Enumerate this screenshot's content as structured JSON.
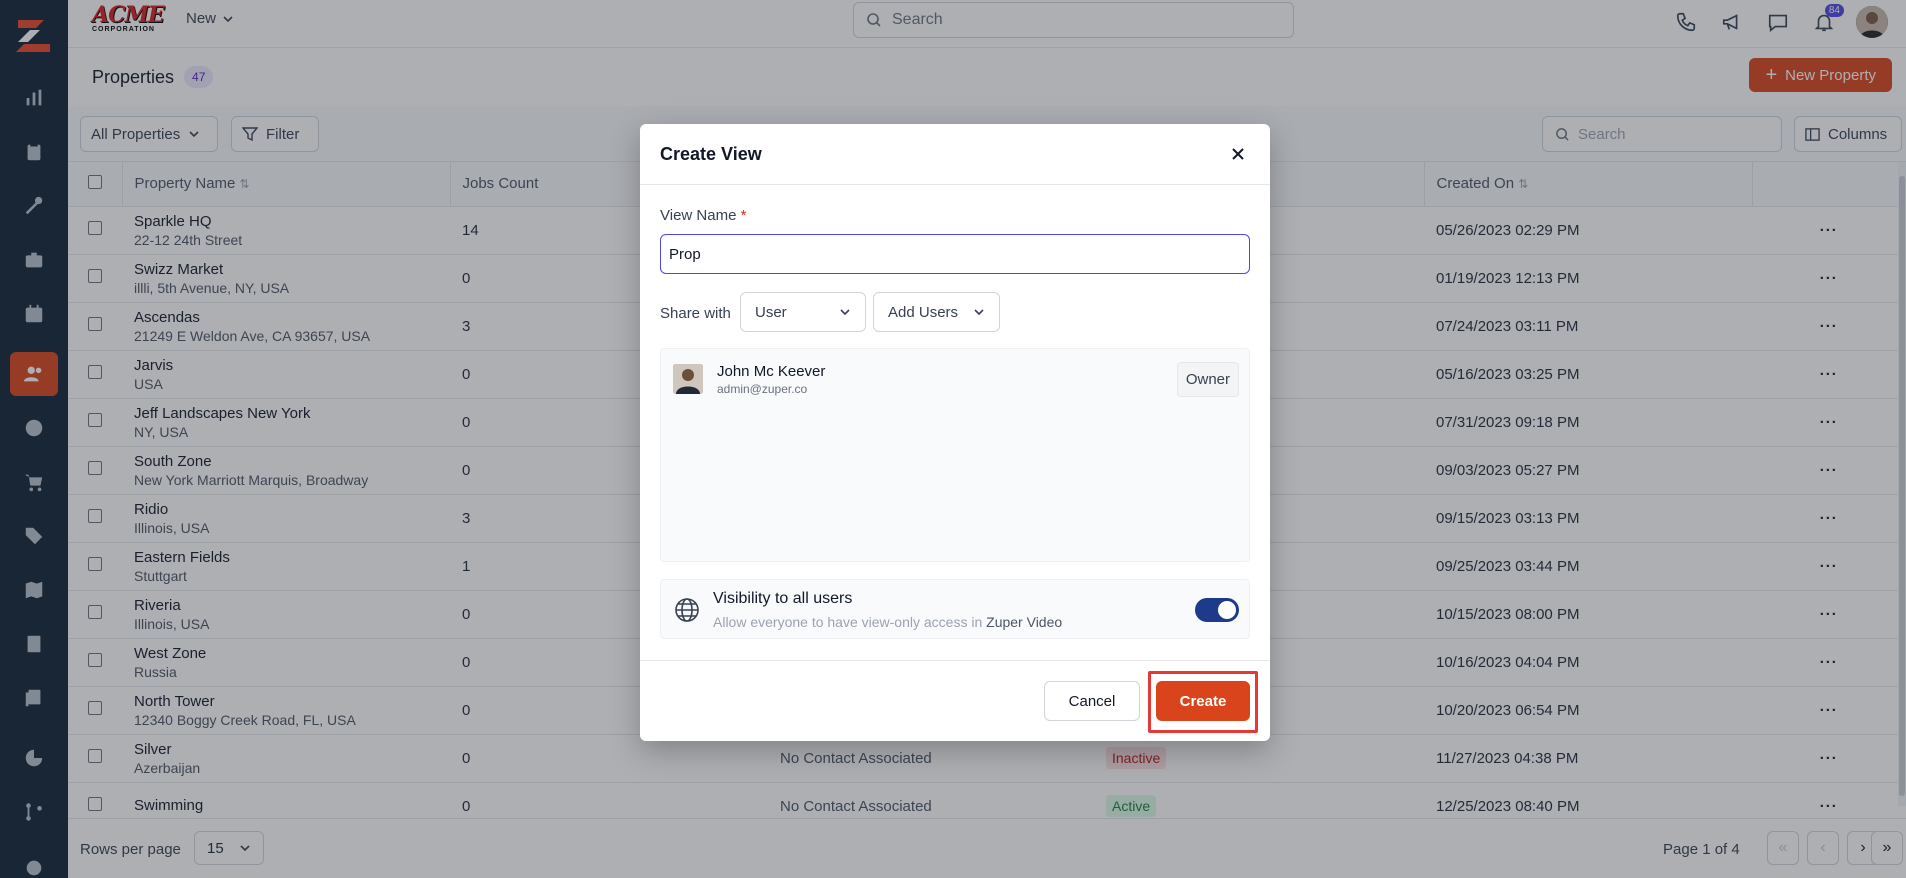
{
  "topbar": {
    "brand_name": "ACME",
    "brand_sub": "CORPORATION",
    "new_label": "New",
    "search_placeholder": "Search",
    "notification_count": "84"
  },
  "page": {
    "title": "Properties",
    "count": "47",
    "new_button": "New Property"
  },
  "filters": {
    "view_select": "All Properties",
    "filter_label": "Filter",
    "search_placeholder": "Search",
    "columns_label": "Columns"
  },
  "table": {
    "headers": [
      "Property Name",
      "Jobs Count",
      "",
      "",
      "Created On"
    ],
    "rows": [
      {
        "name": "Sparkle HQ",
        "address": "22-12 24th Street",
        "jobs": "14",
        "contact": "",
        "status": "",
        "created": "05/26/2023 02:29 PM"
      },
      {
        "name": "Swizz Market",
        "address": "illli, 5th Avenue, NY, USA",
        "jobs": "0",
        "contact": "",
        "status": "",
        "created": "01/19/2023 12:13 PM"
      },
      {
        "name": "Ascendas",
        "address": "21249 E Weldon Ave, CA 93657, USA",
        "jobs": "3",
        "contact": "",
        "status": "",
        "created": "07/24/2023 03:11 PM"
      },
      {
        "name": "Jarvis",
        "address": "USA",
        "jobs": "0",
        "contact": "",
        "status": "",
        "created": "05/16/2023 03:25 PM"
      },
      {
        "name": "Jeff Landscapes New York",
        "address": "NY, USA",
        "jobs": "0",
        "contact": "",
        "status": "",
        "created": "07/31/2023 09:18 PM"
      },
      {
        "name": "South Zone",
        "address": "New York Marriott Marquis, Broadway",
        "jobs": "0",
        "contact": "",
        "status": "",
        "created": "09/03/2023 05:27 PM"
      },
      {
        "name": "Ridio",
        "address": "Illinois, USA",
        "jobs": "3",
        "contact": "",
        "status": "",
        "created": "09/15/2023 03:13 PM"
      },
      {
        "name": "Eastern Fields",
        "address": "Stuttgart",
        "jobs": "1",
        "contact": "",
        "status": "",
        "created": "09/25/2023 03:44 PM"
      },
      {
        "name": "Riveria",
        "address": "Illinois, USA",
        "jobs": "0",
        "contact": "",
        "status": "",
        "created": "10/15/2023 08:00 PM"
      },
      {
        "name": "West Zone",
        "address": "Russia",
        "jobs": "0",
        "contact": "",
        "status": "",
        "created": "10/16/2023 04:04 PM"
      },
      {
        "name": "North Tower",
        "address": "12340 Boggy Creek Road, FL, USA",
        "jobs": "0",
        "contact": "",
        "status": "",
        "created": "10/20/2023 06:54 PM"
      },
      {
        "name": "Silver",
        "address": "Azerbaijan",
        "jobs": "0",
        "contact": "No Contact Associated",
        "status": "Inactive",
        "created": "11/27/2023 04:38 PM"
      },
      {
        "name": "Swimming",
        "address": "",
        "jobs": "0",
        "contact": "No Contact Associated",
        "status": "Active",
        "created": "12/25/2023 08:40 PM"
      }
    ]
  },
  "footer": {
    "rows_label": "Rows per page",
    "rows_value": "15",
    "page_info": "Page 1 of 4"
  },
  "modal": {
    "title": "Create View",
    "view_name_label": "View Name",
    "required_mark": "*",
    "view_name_value": "Prop",
    "share_label": "Share with",
    "share_select": "User",
    "add_users": "Add Users",
    "user": {
      "name": "John Mc Keever",
      "email": "admin@zuper.co",
      "role": "Owner"
    },
    "visibility_title": "Visibility to all users",
    "visibility_desc": "Allow everyone to have view-only access in",
    "visibility_app": "Zuper Video",
    "visibility_enabled": true,
    "cancel": "Cancel",
    "create": "Create"
  },
  "colors": {
    "accent": "#d9441c",
    "sidebar": "#0f2236",
    "toggle": "#1e3a8a",
    "focus": "#4f46e5"
  }
}
